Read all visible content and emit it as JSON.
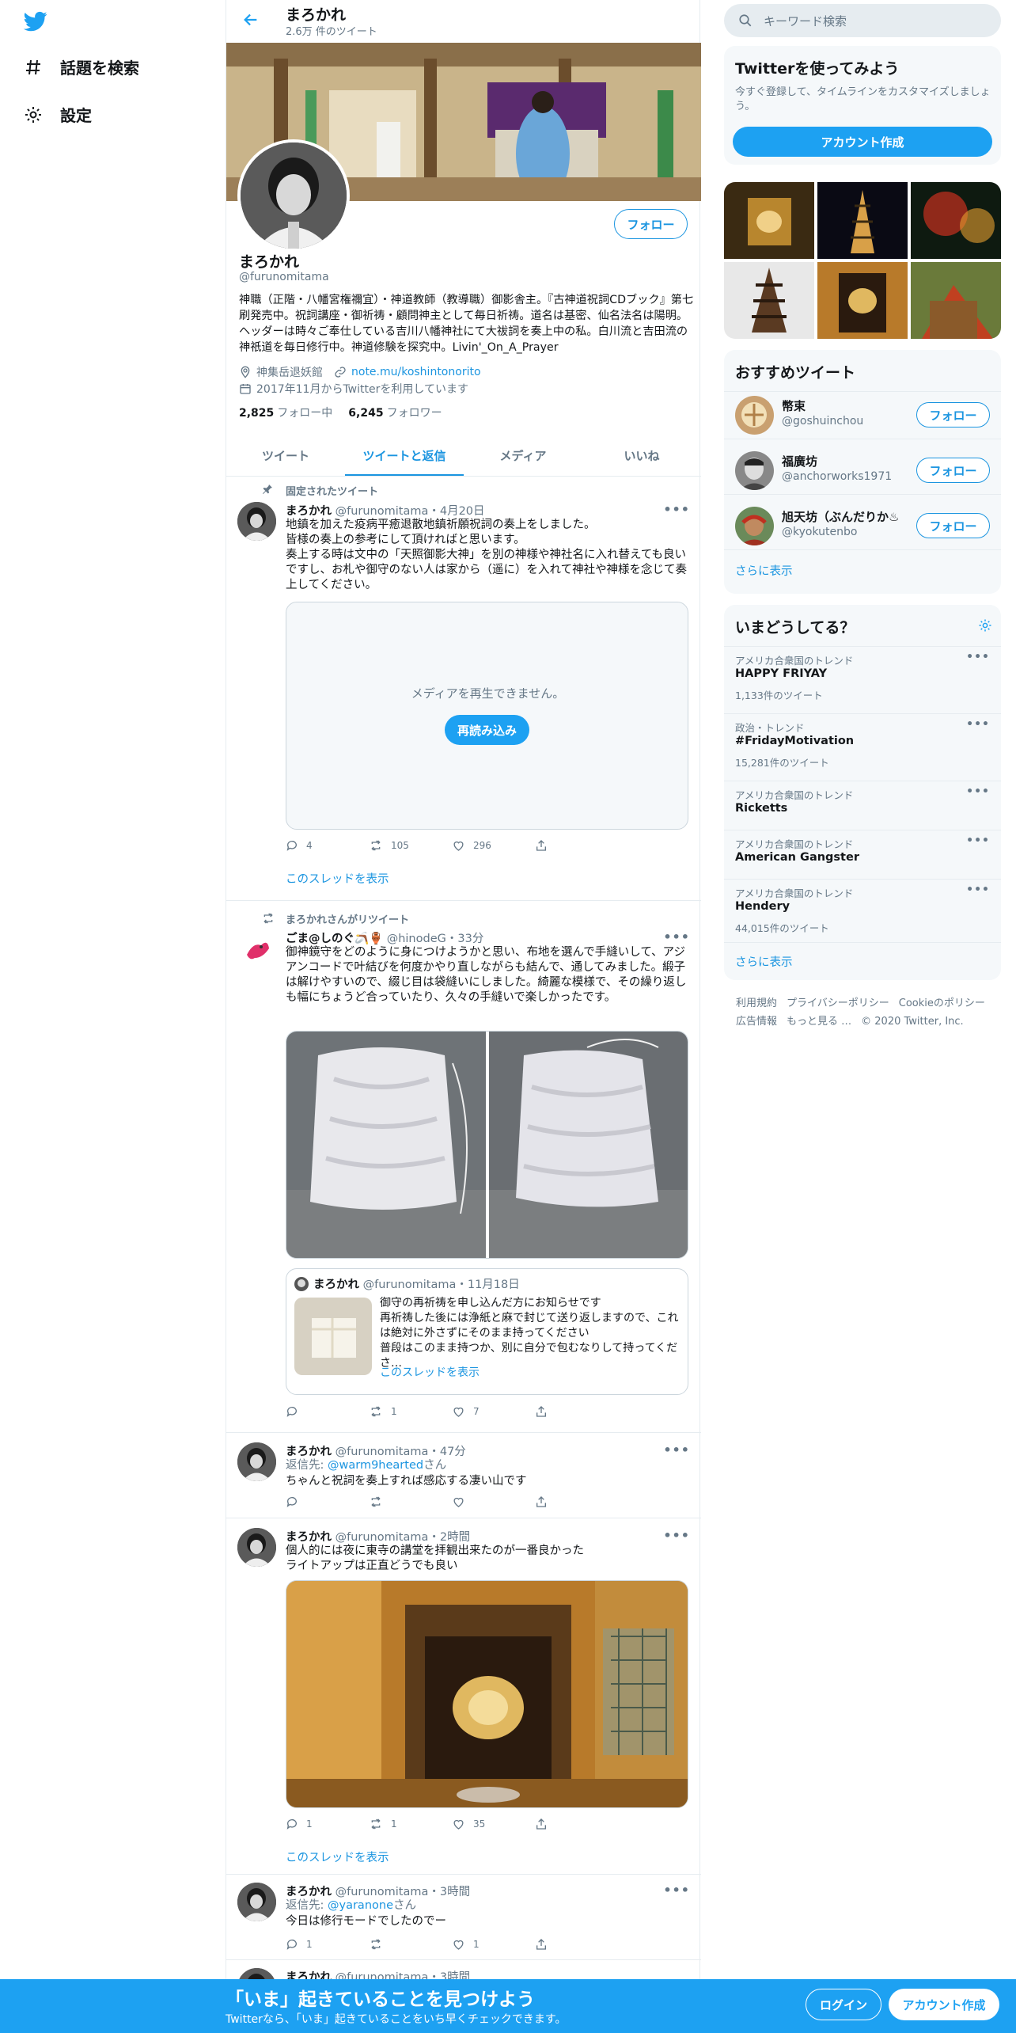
{
  "nav": {
    "items": [
      {
        "label": "話題を検索",
        "icon": "hashtag-icon"
      },
      {
        "label": "設定",
        "icon": "gear-icon"
      }
    ]
  },
  "header": {
    "title": "まろかれ",
    "subtitle": "2.6万 件のツイート"
  },
  "profile": {
    "name": "まろかれ",
    "handle": "@furunomitama",
    "follow_label": "フォロー",
    "bio": "神職（正階・八幡宮権禰宜）・神道教師（教導職）御影舎主。『古神道祝詞CDブック』第七刷発売中。祝詞講座・御祈祷・顧問神主として毎日祈祷。道名は基密、仙名法名は陽明。ヘッダーは時々ご奉仕している吉川八幡神社にて大祓詞を奏上中の私。白川流と吉田流の神祇道を毎日修行中。神道修験を探究中。Livin'_On_A_Prayer",
    "location": "神集岳退妖館",
    "url": "note.mu/koshintonorito",
    "joined": "2017年11月からTwitterを利用しています",
    "following_count": "2,825",
    "following_label": "フォロー中",
    "followers_count": "6,245",
    "followers_label": "フォロワー"
  },
  "tabs": [
    {
      "label": "ツイート",
      "active": false
    },
    {
      "label": "ツイートと返信",
      "active": true
    },
    {
      "label": "メディア",
      "active": false
    },
    {
      "label": "いいね",
      "active": false
    }
  ],
  "tweets": [
    {
      "context": "固定されたツイート",
      "name": "まろかれ",
      "handle": "@furunomitama",
      "time": "・4月20日",
      "text": "地鎮を加えた疫病平癒退散地鎮祈願祝詞の奏上をしました。\n皆様の奏上の参考にして頂ければと思います。\n奏上する時は文中の「天照御影大神」を別の神様や神社名に入れ替えても良いですし、お札や御守のない人は家から（遥に）を入れて神社や神様を念じて奏上してください。",
      "media_error": "メディアを再生できません。",
      "reload_label": "再読み込み",
      "replies": "4",
      "retweets": "105",
      "likes": "296",
      "thread_link": "このスレッドを表示"
    },
    {
      "context": "まろかれさんがリツイート",
      "name": "ごま@しのぐ🪃🏺",
      "handle": "@hinodeG",
      "time": "・33分",
      "text": "御神鏡守をどのように身につけようかと思い、布地を選んで手縫いして、アジアンコードで叶結びを何度かやり直しながらも結んで、通してみました。緞子は解けやすいので、綴じ目は袋縫いにしました。綺麗な模様で、その繰り返しも幅にちょうど合っていたり、久々の手縫いで楽しかったです。",
      "quote": {
        "name": "まろかれ",
        "handle": "@furunomitama",
        "time": "・11月18日",
        "text": "御守の再祈祷を申し込んだ方にお知らせです\n再祈祷した後には浄紙と麻で封じて送り返しますので、これは絶対に外さずにそのまま持ってください\n普段はこのまま持つか、別に自分で包むなりして持ってくださ…",
        "thread_link": "このスレッドを表示"
      },
      "replies": "",
      "retweets": "1",
      "likes": "7"
    },
    {
      "name": "まろかれ",
      "handle": "@furunomitama",
      "time": "・47分",
      "reply_to_prefix": "返信先: ",
      "reply_to": "@warm9hearted",
      "reply_to_suffix": "さん",
      "text": "ちゃんと祝詞を奏上すれば感応する凄い山です",
      "replies": "",
      "retweets": "",
      "likes": ""
    },
    {
      "name": "まろかれ",
      "handle": "@furunomitama",
      "time": "・2時間",
      "text": "個人的には夜に東寺の講堂を拝観出来たのが一番良かった\nライトアップは正直どうでも良い",
      "replies": "1",
      "retweets": "1",
      "likes": "35",
      "thread_link": "このスレッドを表示"
    },
    {
      "name": "まろかれ",
      "handle": "@furunomitama",
      "time": "・3時間",
      "reply_to_prefix": "返信先: ",
      "reply_to": "@yaranone",
      "reply_to_suffix": "さん",
      "text": "今日は修行モードでしたのでー",
      "replies": "1",
      "retweets": "",
      "likes": "1"
    },
    {
      "name": "まろかれ",
      "handle": "@furunomitama",
      "time": "・3時間"
    }
  ],
  "sidebar": {
    "search_placeholder": "キーワード検索",
    "signup_card": {
      "title": "Twitterを使ってみよう",
      "text": "今すぐ登録して、タイムラインをカスタマイズしましょう。",
      "button": "アカウント作成"
    },
    "recommend": {
      "title": "おすすめツイート",
      "users": [
        {
          "name": "幣束",
          "handle": "@goshuinchou",
          "button": "フォロー"
        },
        {
          "name": "福廣坊",
          "handle": "@anchorworks1971",
          "button": "フォロー"
        },
        {
          "name": "旭天坊（ぶんだりか♨",
          "handle": "@kyokutenbo",
          "button": "フォロー"
        }
      ],
      "more": "さらに表示"
    },
    "trends": {
      "title": "いまどうしてる？",
      "items": [
        {
          "context": "アメリカ合衆国のトレンド",
          "name": "HAPPY FRIYAY",
          "count": "1,133件のツイート"
        },
        {
          "context": "政治・トレンド",
          "name": "#FridayMotivation",
          "count": "15,281件のツイート"
        },
        {
          "context": "アメリカ合衆国のトレンド",
          "name": "Ricketts",
          "count": ""
        },
        {
          "context": "アメリカ合衆国のトレンド",
          "name": "American Gangster",
          "count": ""
        },
        {
          "context": "アメリカ合衆国のトレンド",
          "name": "Hendery",
          "count": "44,015件のツイート"
        }
      ],
      "more": "さらに表示"
    },
    "footer": {
      "links": [
        "利用規約",
        "プライバシーポリシー",
        "Cookieのポリシー",
        "広告情報",
        "もっと見る …"
      ],
      "copyright": "© 2020 Twitter, Inc."
    }
  },
  "bottom_bar": {
    "title": "「いま」起きていることを見つけよう",
    "subtitle": "Twitterなら、「いま」起きていることをいち早くチェックできます。",
    "login": "ログイン",
    "signup": "アカウント作成"
  },
  "colors": {
    "brand": "#1da1f2",
    "link": "#1b95e0",
    "muted": "#657786"
  }
}
